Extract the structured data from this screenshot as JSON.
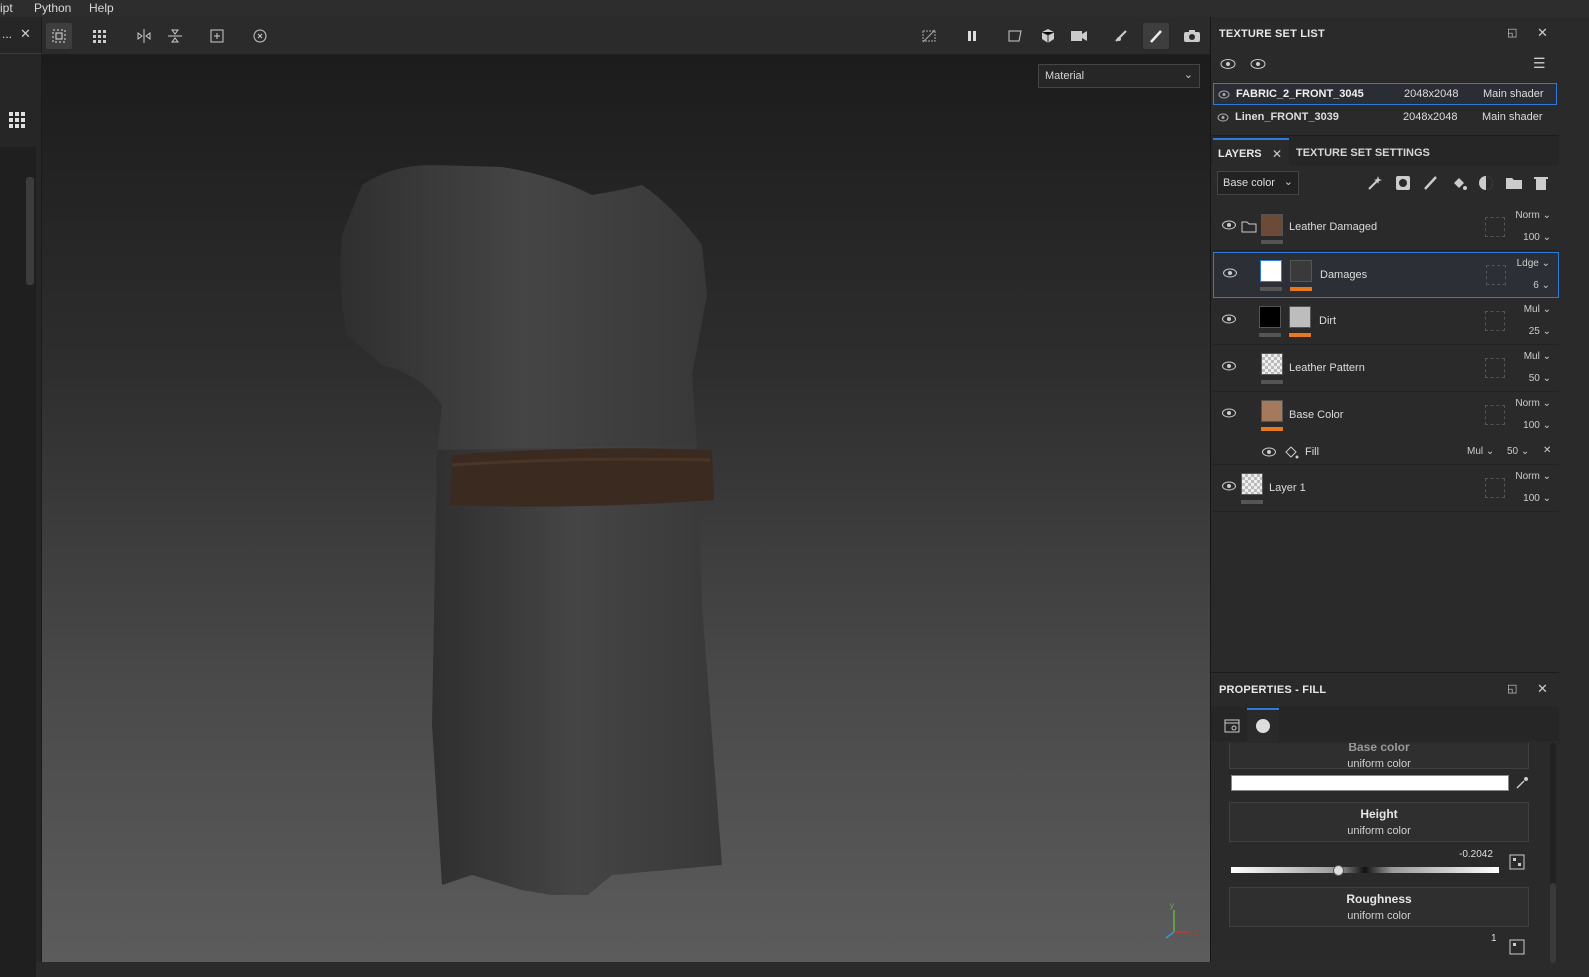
{
  "menu": {
    "items": [
      "ipt",
      "Python",
      "Help"
    ]
  },
  "left": {
    "tab_label": "...",
    "close": "✕"
  },
  "viewport": {
    "display_mode": "Material",
    "axis": {
      "x": "x",
      "y": "y"
    }
  },
  "texture_set_list": {
    "title": "TEXTURE SET LIST",
    "rows": [
      {
        "name": "FABRIC_2_FRONT_3045",
        "size": "2048x2048",
        "shader": "Main shader"
      },
      {
        "name": "Linen_FRONT_3039",
        "size": "2048x2048",
        "shader": "Main shader"
      }
    ]
  },
  "layers_panel": {
    "tab_layers": "LAYERS",
    "tab_settings": "TEXTURE SET SETTINGS",
    "channel": "Base color",
    "layers": [
      {
        "name": "Leather Damaged",
        "blend": "Norm",
        "opacity": "100"
      },
      {
        "name": "Damages",
        "blend": "Ldge",
        "opacity": "6"
      },
      {
        "name": "Dirt",
        "blend": "Mul",
        "opacity": "25"
      },
      {
        "name": "Leather Pattern",
        "blend": "Mul",
        "opacity": "50"
      },
      {
        "name": "Base Color",
        "blend": "Norm",
        "opacity": "100"
      },
      {
        "name": "Layer 1",
        "blend": "Norm",
        "opacity": "100"
      }
    ],
    "effect": {
      "name": "Fill",
      "blend": "Mul",
      "opacity": "50"
    }
  },
  "properties": {
    "title": "PROPERTIES - FILL",
    "base_color": {
      "title": "Base color",
      "sub": "uniform color"
    },
    "height": {
      "title": "Height",
      "sub": "uniform color",
      "value": "-0.2042",
      "slider": 0.4
    },
    "roughness": {
      "title": "Roughness",
      "sub": "uniform color",
      "value": "1"
    }
  },
  "colors": {
    "accent": "#2e7ad6",
    "orange": "#e8781e"
  }
}
